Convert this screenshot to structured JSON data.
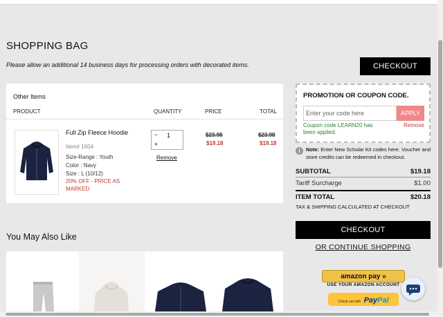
{
  "page": {
    "title": "SHOPPING BAG",
    "notice": "Please allow an additional 14 business days for processing orders with decorated items."
  },
  "checkout_top": "CHECKOUT",
  "cart": {
    "section": "Other Items",
    "headers": {
      "product": "PRODUCT",
      "quantity": "QUANTITY",
      "price": "PRICE",
      "total": "TOTAL"
    },
    "item": {
      "name": "Full Zip Fleece Hoodie",
      "item_no": "Item# 1604",
      "size_range": "Size-Range : Youth",
      "color": "Color : Navy",
      "size": "Size : L (10/12)",
      "discount": "20% OFF - PRICE AS MARKED",
      "qty": "1",
      "qty_minus": "−",
      "qty_plus": "+",
      "remove": "Remove",
      "price_orig": "$23.98",
      "price_sale": "$19.18",
      "total_orig": "$23.98",
      "total_sale": "$19.18"
    }
  },
  "promo": {
    "title": "PROMOTION OR COUPON CODE.",
    "placeholder": "Enter your code here",
    "apply": "APPLY",
    "applied_msg": "Coupon code LEARN20 has been applied.",
    "remove": "Remove"
  },
  "note": {
    "icon": "i",
    "label": "Note:",
    "text": "Enter New Scholar Kit codes here. Voucher and store credits can be redeemed in checkout."
  },
  "summary": {
    "subtotal_label": "SUBTOTAL",
    "subtotal": "$19.18",
    "surcharge_label": "Tariff Surcharge",
    "surcharge": "$1.00",
    "item_total_label": "ITEM TOTAL",
    "item_total": "$20.18",
    "tax_note": "TAX & SHIPPING CALCULATED AT CHECKOUT"
  },
  "checkout_main": "CHECKOUT",
  "continue": "OR CONTINUE SHOPPING",
  "payments": {
    "amazon": "amazon pay",
    "amazon_arrows": "»",
    "amazon_sub": "USE YOUR AMAZON ACCOUNT",
    "paypal_prefix": "Check out with",
    "paypal_a": "Pay",
    "paypal_b": "Pal"
  },
  "related": {
    "title": "You May Also Like"
  },
  "colors": {
    "accent": "#000000",
    "sale": "#c0392b",
    "apply": "#f0888a",
    "success": "#2e7d32",
    "navy": "#1c2340"
  }
}
